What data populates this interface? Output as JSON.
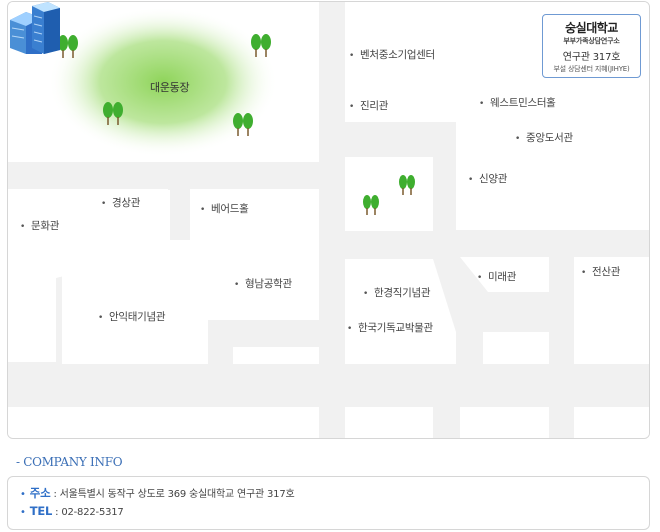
{
  "map": {
    "park_label": "대운동장",
    "buildings": [
      {
        "id": "venture",
        "label": "벤처중소기업센터"
      },
      {
        "id": "jinri",
        "label": "진리관"
      },
      {
        "id": "westminster",
        "label": "웨스트민스터홀"
      },
      {
        "id": "library",
        "label": "중앙도서관"
      },
      {
        "id": "sinyang",
        "label": "신양관"
      },
      {
        "id": "gyeongsang",
        "label": "경상관"
      },
      {
        "id": "munhwa",
        "label": "문화관"
      },
      {
        "id": "baird",
        "label": "베어드홀"
      },
      {
        "id": "hyeongnam",
        "label": "형남공학관"
      },
      {
        "id": "anik",
        "label": "안익태기념관"
      },
      {
        "id": "hangyeongjik",
        "label": "한경직기념관"
      },
      {
        "id": "museum",
        "label": "한국기독교박물관"
      },
      {
        "id": "mirae",
        "label": "미래관"
      },
      {
        "id": "jeonsan",
        "label": "전산관"
      }
    ],
    "callout": {
      "line1": "숭실대학교",
      "line2": "부부가족상담연구소",
      "line3": "연구관 317호",
      "line4": "부설 상담센터 지혜(JIHYE)"
    },
    "colors": {
      "road": "#ffffff",
      "ground": "#f1f1f1",
      "park": "#8fd45a",
      "accent": "#3b6fb6"
    }
  },
  "company": {
    "title": "- COMPANY INFO",
    "address_key": "주소",
    "address_value": "서울특별시 동작구 상도로 369 숭실대학교 연구관 317호",
    "tel_key": "TEL",
    "tel_value": "02-822-5317"
  }
}
